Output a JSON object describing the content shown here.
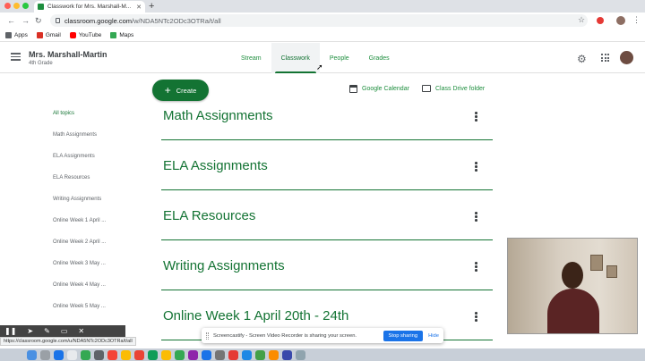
{
  "browser": {
    "tab_title": "Classwork for Mrs. Marshall-M...",
    "url_host": "classroom.google.com",
    "url_path": "/w/NDA5NTc2ODc3OTRa/t/all",
    "bookmarks": [
      {
        "label": "Apps",
        "icon": "apps-grid-icon",
        "color": "#5f6368"
      },
      {
        "label": "Gmail",
        "icon": "gmail-icon",
        "color": "#d93025"
      },
      {
        "label": "YouTube",
        "icon": "youtube-icon",
        "color": "#ff0000"
      },
      {
        "label": "Maps",
        "icon": "maps-icon",
        "color": "#34a853"
      }
    ],
    "status_url": "https://classroom.google.com/u/NDA5NTc2ODc3OTRa/t/all"
  },
  "classroom": {
    "class_name": "Mrs. Marshall-Martin",
    "section": "4th Grade",
    "tabs": [
      {
        "label": "Stream",
        "active": false
      },
      {
        "label": "Classwork",
        "active": true
      },
      {
        "label": "People",
        "active": false
      },
      {
        "label": "Grades",
        "active": false
      }
    ],
    "accent_color": "#137333"
  },
  "actions": {
    "create_label": "Create",
    "calendar_label": "Google Calendar",
    "drive_label": "Class Drive folder"
  },
  "topics": [
    {
      "label": "All topics",
      "active": true
    },
    {
      "label": "Math Assignments",
      "active": false
    },
    {
      "label": "ELA Assignments",
      "active": false
    },
    {
      "label": "ELA Resources",
      "active": false
    },
    {
      "label": "Writing Assignments",
      "active": false
    },
    {
      "label": "Online Week 1 April ...",
      "active": false
    },
    {
      "label": "Online Week 2 April ...",
      "active": false
    },
    {
      "label": "Online Week 3 May ...",
      "active": false
    },
    {
      "label": "Online Week 4 May ...",
      "active": false
    },
    {
      "label": "Online Week 5 May ...",
      "active": false
    }
  ],
  "sections": [
    {
      "title": "Math Assignments"
    },
    {
      "title": "ELA Assignments"
    },
    {
      "title": "ELA Resources"
    },
    {
      "title": "Writing Assignments"
    },
    {
      "title": "Online Week 1 April 20th - 24th"
    }
  ],
  "sharebar": {
    "message": "Screencastify - Screen Video Recorder is sharing your screen.",
    "stop_label": "Stop sharing",
    "hide_label": "Hide"
  }
}
